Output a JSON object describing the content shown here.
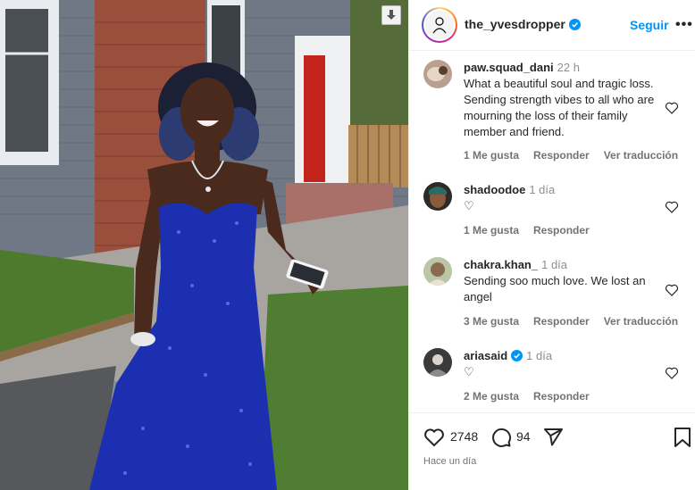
{
  "post": {
    "username": "the_yvesdropper",
    "follow_label": "Seguir",
    "more_label": "•••"
  },
  "comments": [
    {
      "user": "paw.squad_dani",
      "time": "22 h",
      "text": "What a beautiful soul and tragic loss. Sending strength vibes to all who are mourning the loss of their family member and friend.",
      "likes": "1 Me gusta",
      "reply": "Responder",
      "translate": "Ver traducción"
    },
    {
      "user": "shadoodoe",
      "time": "1 día",
      "text": "♡",
      "likes": "1 Me gusta",
      "reply": "Responder",
      "translate": ""
    },
    {
      "user": "chakra.khan_",
      "time": "1 día",
      "text": "Sending soo much love. We lost an angel",
      "likes": "3 Me gusta",
      "reply": "Responder",
      "translate": "Ver traducción"
    },
    {
      "user": "ariasaid",
      "verified": true,
      "time": "1 día",
      "text": "♡",
      "likes": "2 Me gusta",
      "reply": "Responder",
      "translate": ""
    }
  ],
  "footer": {
    "like_count": "2748",
    "comment_count": "94",
    "date": "Hace un día"
  },
  "colors": {
    "accent": "#0095f6",
    "text": "#262626",
    "secondary": "#737373",
    "dress": "#1c2fb0"
  },
  "icons": [
    "download-icon",
    "verified-icon",
    "heart-icon",
    "comment-icon",
    "share-icon",
    "bookmark-icon"
  ]
}
